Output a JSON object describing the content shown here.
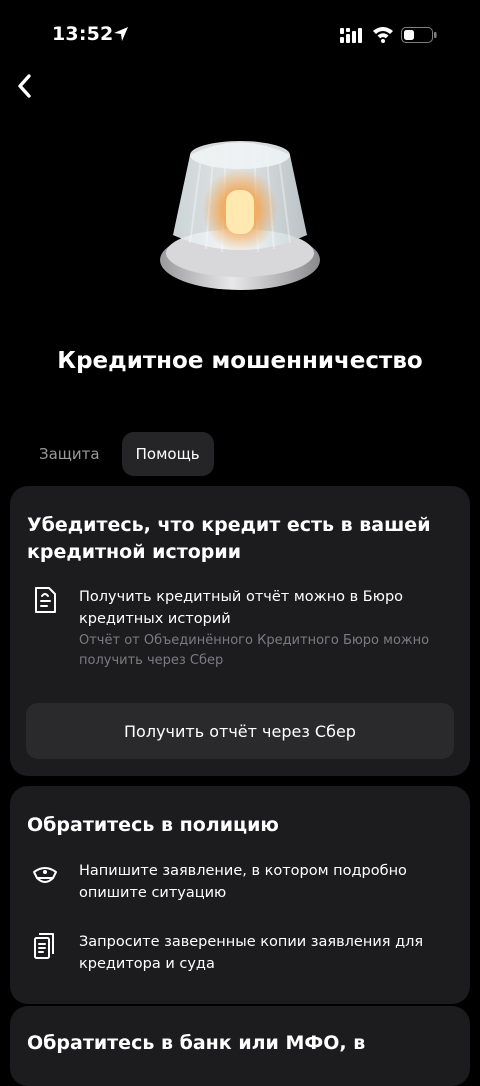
{
  "status_bar": {
    "time": "13:52"
  },
  "header": {
    "title": "Кредитное мошенничество"
  },
  "tabs": [
    {
      "label": "Защита",
      "active": false
    },
    {
      "label": "Помощь",
      "active": true
    }
  ],
  "cards": [
    {
      "title": "Убедитесь, что кредит есть в вашей кредитной истории",
      "items": [
        {
          "icon": "document-icon",
          "text": "Получить кредитный отчёт можно в Бюро кредитных историй",
          "subtext": "Отчёт от Объединённого Кредитного Бюро можно получить через Сбер"
        }
      ],
      "button_label": "Получить отчёт через Сбер"
    },
    {
      "title": "Обратитесь в полицию",
      "items": [
        {
          "icon": "police-cap-icon",
          "text": "Напишите заявление, в котором подробно опишите ситуацию"
        },
        {
          "icon": "documents-copy-icon",
          "text": "Запросите заверенные копии заявления для кредитора и суда"
        }
      ]
    },
    {
      "title": "Обратитесь в банк или МФО, в"
    }
  ],
  "colors": {
    "background": "#000000",
    "card": "#1c1c1e",
    "button": "#2a2a2c",
    "secondary_text": "#7c7c80"
  }
}
